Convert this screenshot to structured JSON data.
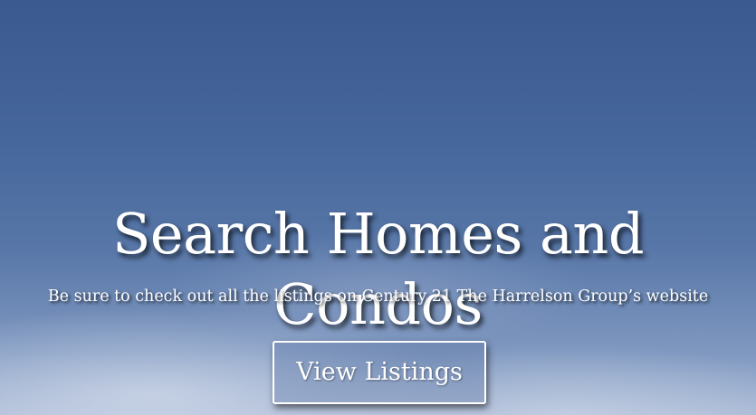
{
  "hero": {
    "title": "Search Homes and Condos",
    "subtitle": "Be sure to check out all the listings on Century 21 The Harrelson Group’s website",
    "button_label": "View Listings"
  },
  "colors": {
    "sky_top": "#3b5a8f",
    "sky_bottom": "#a9b9d5",
    "text": "#ffffff"
  }
}
